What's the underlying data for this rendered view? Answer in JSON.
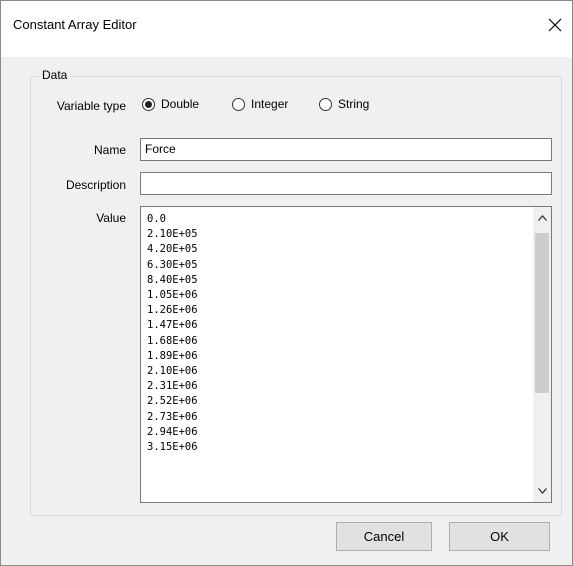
{
  "window": {
    "title": "Constant Array Editor"
  },
  "group": {
    "legend": "Data"
  },
  "variable_type": {
    "label": "Variable type",
    "options": [
      {
        "label": "Double",
        "selected": true
      },
      {
        "label": "Integer",
        "selected": false
      },
      {
        "label": "String",
        "selected": false
      }
    ]
  },
  "name": {
    "label": "Name",
    "value": "Force"
  },
  "description": {
    "label": "Description",
    "value": ""
  },
  "value": {
    "label": "Value",
    "lines": [
      "0.0",
      "2.10E+05",
      "4.20E+05",
      "6.30E+05",
      "8.40E+05",
      "1.05E+06",
      "1.26E+06",
      "1.47E+06",
      "1.68E+06",
      "1.89E+06",
      "2.10E+06",
      "2.31E+06",
      "2.52E+06",
      "2.73E+06",
      "2.94E+06",
      "3.15E+06"
    ]
  },
  "buttons": {
    "cancel": "Cancel",
    "ok": "OK"
  }
}
